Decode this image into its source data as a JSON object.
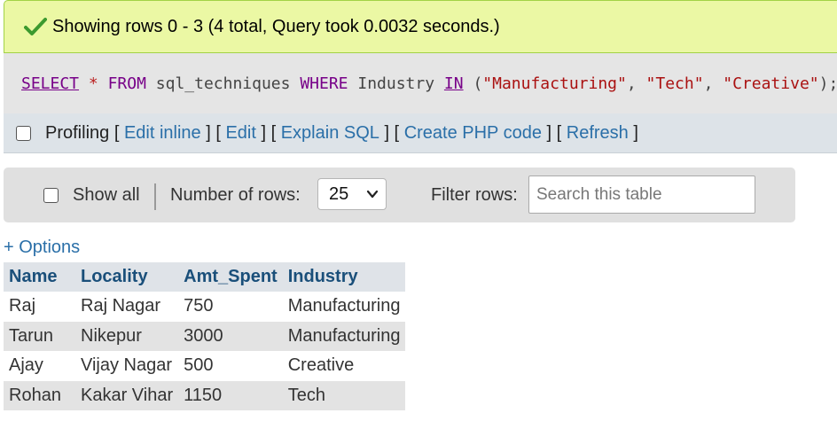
{
  "status": {
    "message": "Showing rows 0 - 3 (4 total, Query took 0.0032 seconds.)",
    "icon": "checkmark-icon",
    "color": "#3c9a2f"
  },
  "sql": {
    "t1": "SELECT",
    "t2": "*",
    "t3": "FROM",
    "t4": "sql_techniques",
    "t5": "WHERE",
    "t6": "Industry",
    "t7": "IN",
    "t8": "(",
    "t9": "\"Manufacturing\"",
    "t10": ",",
    "t11": "\"Tech\"",
    "t12": ",",
    "t13": "\"Creative\"",
    "t14": ");"
  },
  "profiling": {
    "label": "Profiling",
    "links": [
      "Edit inline",
      "Edit",
      "Explain SQL",
      "Create PHP code",
      "Refresh"
    ]
  },
  "nav": {
    "show_all_label": "Show all",
    "rows_label": "Number of rows:",
    "rows_value": "25",
    "filter_label": "Filter rows:",
    "search_placeholder": "Search this table"
  },
  "options_label": "+ Options",
  "table": {
    "headers": [
      "Name",
      "Locality",
      "Amt_Spent",
      "Industry"
    ],
    "rows": [
      [
        "Raj",
        "Raj Nagar",
        "750",
        "Manufacturing"
      ],
      [
        "Tarun",
        "Nikepur",
        "3000",
        "Manufacturing"
      ],
      [
        "Ajay",
        "Vijay Nagar",
        "500",
        "Creative"
      ],
      [
        "Rohan",
        "Kakar Vihar",
        "1150",
        "Tech"
      ]
    ]
  }
}
